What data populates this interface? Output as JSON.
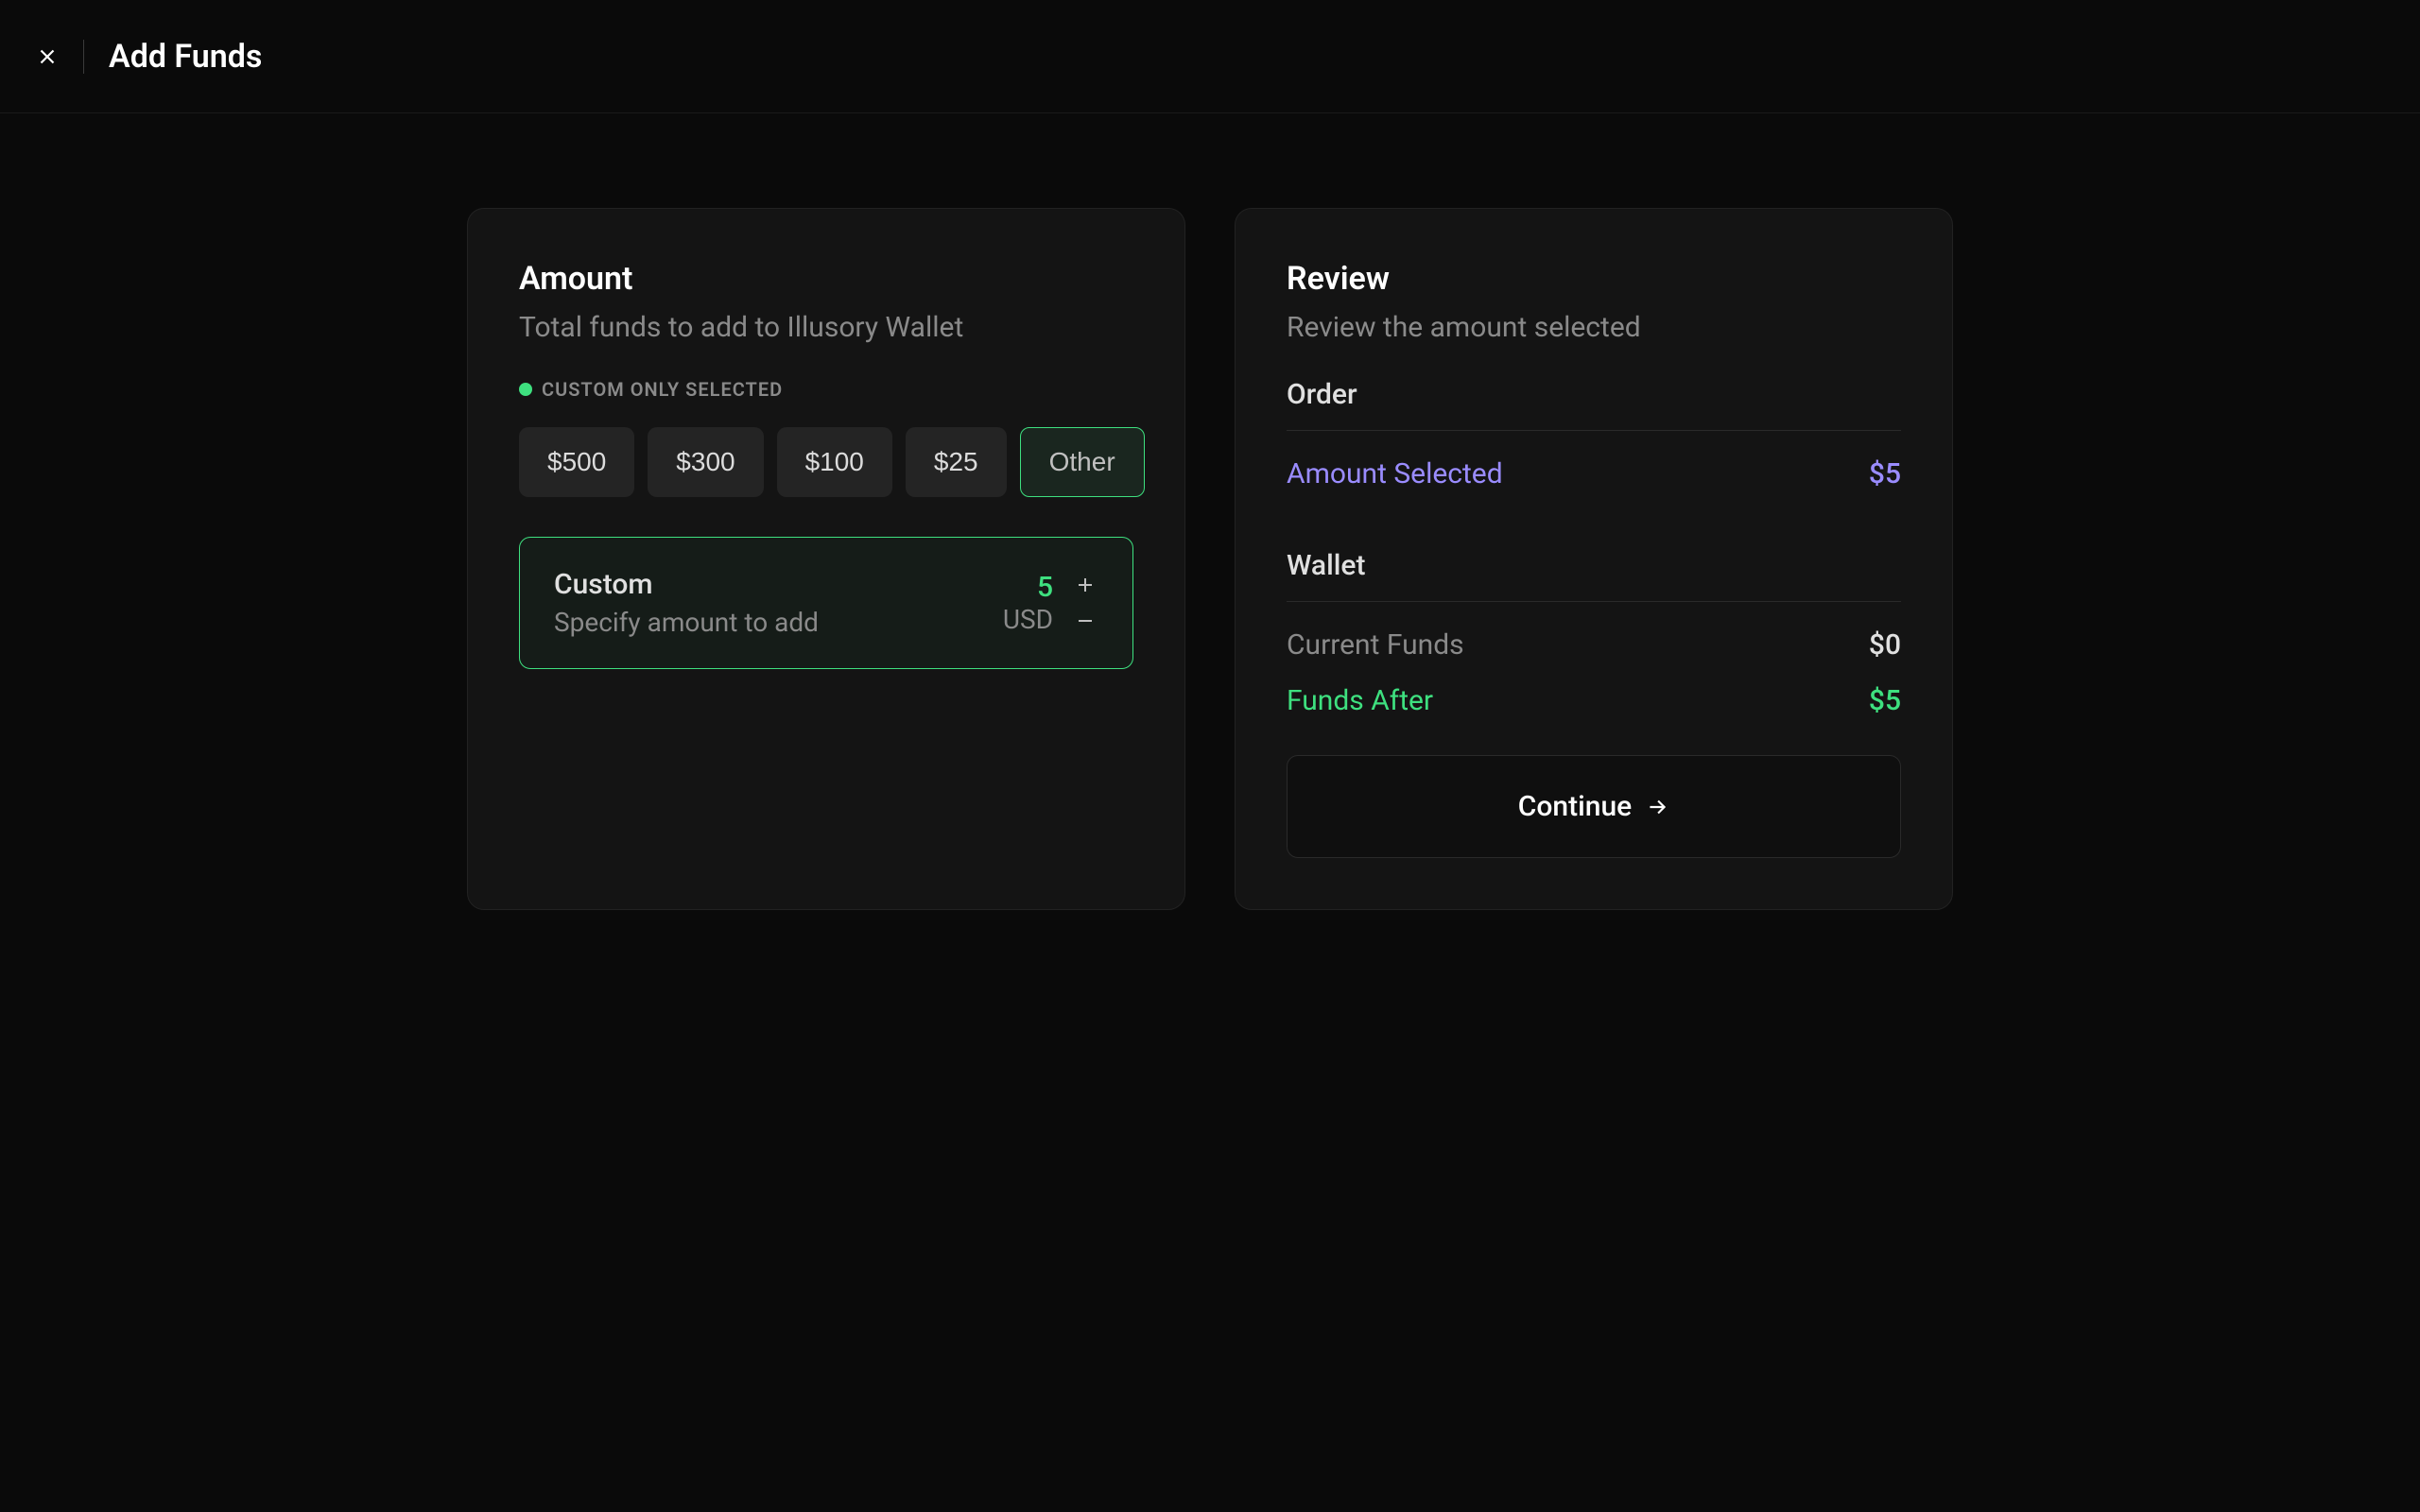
{
  "header": {
    "title": "Add Funds"
  },
  "amount_card": {
    "title": "Amount",
    "subtitle": "Total funds to add to Illusory Wallet",
    "status": "CUSTOM ONLY SELECTED",
    "presets": [
      "$500",
      "$300",
      "$100",
      "$25",
      "Other"
    ],
    "selected_preset_index": 4,
    "custom": {
      "label": "Custom",
      "sublabel": "Specify amount to add",
      "value": "5",
      "currency": "USD"
    }
  },
  "review_card": {
    "title": "Review",
    "subtitle": "Review the amount selected",
    "order": {
      "header": "Order",
      "amount_selected_label": "Amount Selected",
      "amount_selected_value": "$5"
    },
    "wallet": {
      "header": "Wallet",
      "current_label": "Current Funds",
      "current_value": "$0",
      "after_label": "Funds After",
      "after_value": "$5"
    },
    "continue_label": "Continue"
  },
  "colors": {
    "accent_green": "#3ee07f",
    "accent_violet": "#9a8cff",
    "bg": "#0a0a0a",
    "card_bg": "#141414"
  }
}
